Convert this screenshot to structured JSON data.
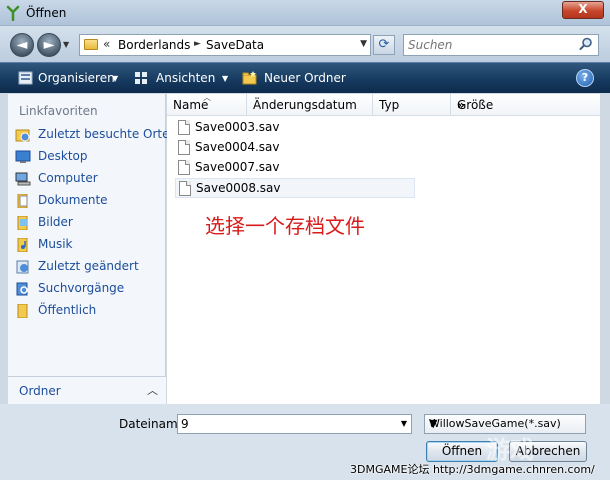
{
  "window": {
    "title": "Öffnen",
    "close_label": "X"
  },
  "address": {
    "back_label": "◄",
    "forward_label": "►",
    "overflow": "«",
    "path": [
      "Borderlands",
      "SaveData"
    ],
    "search_placeholder": "Suchen"
  },
  "toolbar": {
    "organize": "Organisieren",
    "views": "Ansichten",
    "new_folder": "Neuer Ordner",
    "help": "?"
  },
  "sidebar": {
    "heading": "Linkfavoriten",
    "items": [
      {
        "label": "Zuletzt besuchte Orte",
        "icon": "recent-places-icon"
      },
      {
        "label": "Desktop",
        "icon": "desktop-icon"
      },
      {
        "label": "Computer",
        "icon": "computer-icon"
      },
      {
        "label": "Dokumente",
        "icon": "documents-icon"
      },
      {
        "label": "Bilder",
        "icon": "pictures-icon"
      },
      {
        "label": "Musik",
        "icon": "music-icon"
      },
      {
        "label": "Zuletzt geändert",
        "icon": "recently-changed-icon"
      },
      {
        "label": "Suchvorgänge",
        "icon": "searches-icon"
      },
      {
        "label": "Öffentlich",
        "icon": "public-folder-icon"
      }
    ],
    "folders_label": "Ordner"
  },
  "file_list": {
    "columns": [
      "Name",
      "Änderungsdatum",
      "Typ",
      "Größe"
    ],
    "more": "»",
    "files": [
      "Save0003.sav",
      "Save0004.sav",
      "Save0007.sav",
      "Save0008.sav"
    ],
    "selected": "Save0008.sav"
  },
  "annotation": "选择一个存档文件",
  "bottom": {
    "filename_label": "Dateiname:",
    "filename_value": "9",
    "filetype": "WillowSaveGame(*.sav)",
    "open": "Öffnen",
    "cancel": "Abbrechen"
  },
  "watermark": {
    "logo": "游戏",
    "text": "3DMGAME论坛 http://3dmgame.chnren.com/"
  },
  "colors": {
    "accent": "#1c4d9c",
    "toolbar": "#173b61",
    "annotation": "#d81b1b"
  }
}
